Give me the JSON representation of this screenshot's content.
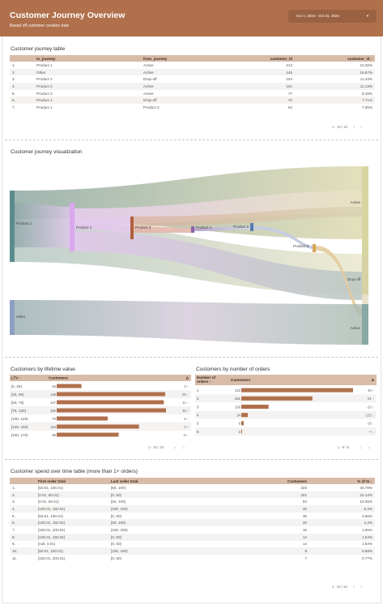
{
  "header": {
    "title": "Customer Journey Overview",
    "subtitle": "Based off customer creation date",
    "date_range": "Oct 1, 2024 - Oct 31, 2024"
  },
  "journey_table": {
    "title": "Customer journey table",
    "columns": [
      "",
      "to_journey",
      "from_journey",
      "customer_id",
      "customer_id ↓"
    ],
    "rows": [
      [
        "1.",
        "Product 1",
        "Active",
        "213",
        "23.35%"
      ],
      [
        "2.",
        "Other",
        "Active",
        "145",
        "15.87%"
      ],
      [
        "3.",
        "Product 2",
        "Drop-off",
        "104",
        "11.43%"
      ],
      [
        "4.",
        "Product 2",
        "Active",
        "101",
        "11.13%"
      ],
      [
        "5.",
        "Product 2",
        "Active",
        "77",
        "8.48%"
      ],
      [
        "6.",
        "Product 1",
        "Drop-off",
        "70",
        "7.71%"
      ],
      [
        "7.",
        "Product 1",
        "Product 2",
        "64",
        "7.05%"
      ]
    ],
    "pager": "1 - 19 / 19"
  },
  "sankey": {
    "title": "Customer journey visualization",
    "nodes": [
      "Product 1",
      "Product 2",
      "Product 3",
      "Product 4",
      "Product 5",
      "Product 6",
      "Other",
      "Active",
      "Drop-off"
    ]
  },
  "ltv_table": {
    "title": "Customers by lifetime value",
    "columns": [
      "LTV ↑",
      "Customers",
      "Δ"
    ],
    "max": 150,
    "rows": [
      {
        "label": "[0, 25)",
        "value": 34,
        "delta": "3 ↑"
      },
      {
        "label": "[25, 50)",
        "value": 149,
        "delta": "26 ↑"
      },
      {
        "label": "[50, 75)",
        "value": 147,
        "delta": "11 ↑"
      },
      {
        "label": "[75, 100)",
        "value": 150,
        "delta": "45 ↑"
      },
      {
        "label": "[100, 125)",
        "value": 70,
        "delta": "9 ↑"
      },
      {
        "label": "[125, 150)",
        "value": 113,
        "delta": "3 ↑"
      },
      {
        "label": "[150, 175)",
        "value": 85,
        "delta": "-5 ↓"
      }
    ],
    "pager": "1 - 20 / 20"
  },
  "orders_table": {
    "title": "Customers by number of orders",
    "columns": [
      "Number of orders ↑",
      "Customers",
      "Δ"
    ],
    "max": 410,
    "rows": [
      {
        "label": "1",
        "value": 410,
        "delta": "49 ↑"
      },
      {
        "label": "2",
        "value": 261,
        "delta": "81 ↑"
      },
      {
        "label": "3",
        "value": 100,
        "delta": "-10 ↓"
      },
      {
        "label": "4",
        "value": 24,
        "delta": "-123 ↓"
      },
      {
        "label": "5",
        "value": 9,
        "delta": "-16 ↓"
      },
      {
        "label": "6",
        "value": 3,
        "delta": "-7 ↓"
      }
    ],
    "pager": "1 - 6 / 6"
  },
  "spend_table": {
    "title": "Customer spend over time table (more than 1+ orders)",
    "columns": [
      "",
      "First order total",
      "Last order total",
      "Customers",
      "% of to ↓"
    ],
    "rows": [
      [
        "1.",
        "[50.01, 100.01)",
        "[50, 100)",
        "325",
        "30.78%"
      ],
      [
        "2.",
        "[0.01, 50.01)",
        "[0, 50)",
        "201",
        "22.13%"
      ],
      [
        "3.",
        "[0.01, 50.01)",
        "[50, 100)",
        "94",
        "10.35%"
      ],
      [
        "4.",
        "[100.01, 150.01)",
        "[100, 150)",
        "46",
        "5.4%"
      ],
      [
        "5.",
        "[50.01, 100.01)",
        "[0, 50)",
        "35",
        "3.66%"
      ],
      [
        "6.",
        "[100.01, 150.01)",
        "[50, 100)",
        "20",
        "2.2%"
      ],
      [
        "7.",
        "[150.01, 200.01)",
        "[150, 200)",
        "15",
        "1.65%"
      ],
      [
        "8.",
        "[100.01, 150.01)",
        "[0, 50)",
        "14",
        "1.54%"
      ],
      [
        "9.",
        "[null, 0.01)",
        "[0, 50)",
        "14",
        "1.54%"
      ],
      [
        "10.",
        "[50.01, 100.01)",
        "[100, 150)",
        "8",
        "0.88%"
      ],
      [
        "11.",
        "[150.01, 200.01)",
        "[0, 50)",
        "7",
        "0.77%"
      ]
    ],
    "pager": "1 - 23 / 23"
  }
}
